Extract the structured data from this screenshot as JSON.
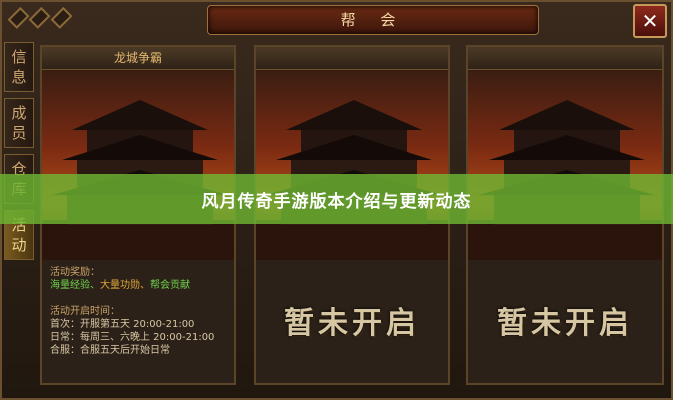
{
  "window": {
    "title": "帮 会",
    "close_glyph": "✕"
  },
  "sidebar": {
    "tabs": [
      {
        "label": "信息"
      },
      {
        "label": "成员"
      },
      {
        "label": "仓库"
      },
      {
        "label": "活动"
      }
    ]
  },
  "panels": [
    {
      "header": "龙城争霸",
      "reward_title": "活动奖励：",
      "reward_a": "海量经验、",
      "reward_b": "大量功勋、",
      "reward_c": "帮会贡献",
      "time_title": "活动开启时间：",
      "time_rows": [
        {
          "label": "首次：",
          "value": "开服第五天 20:00-21:00"
        },
        {
          "label": "日常：",
          "value": "每周三、六晚上 20:00-21:00"
        },
        {
          "label": "合服：",
          "value": "合服五天后开始日常"
        }
      ]
    },
    {
      "locked_text": "暂未开启"
    },
    {
      "locked_text": "暂未开启"
    }
  ],
  "banner": {
    "text": "风月传奇手游版本介绍与更新动态"
  },
  "colors": {
    "banner": "#6eb432",
    "reward_green": "#6fd04d",
    "reward_orange": "#e0a53a"
  }
}
